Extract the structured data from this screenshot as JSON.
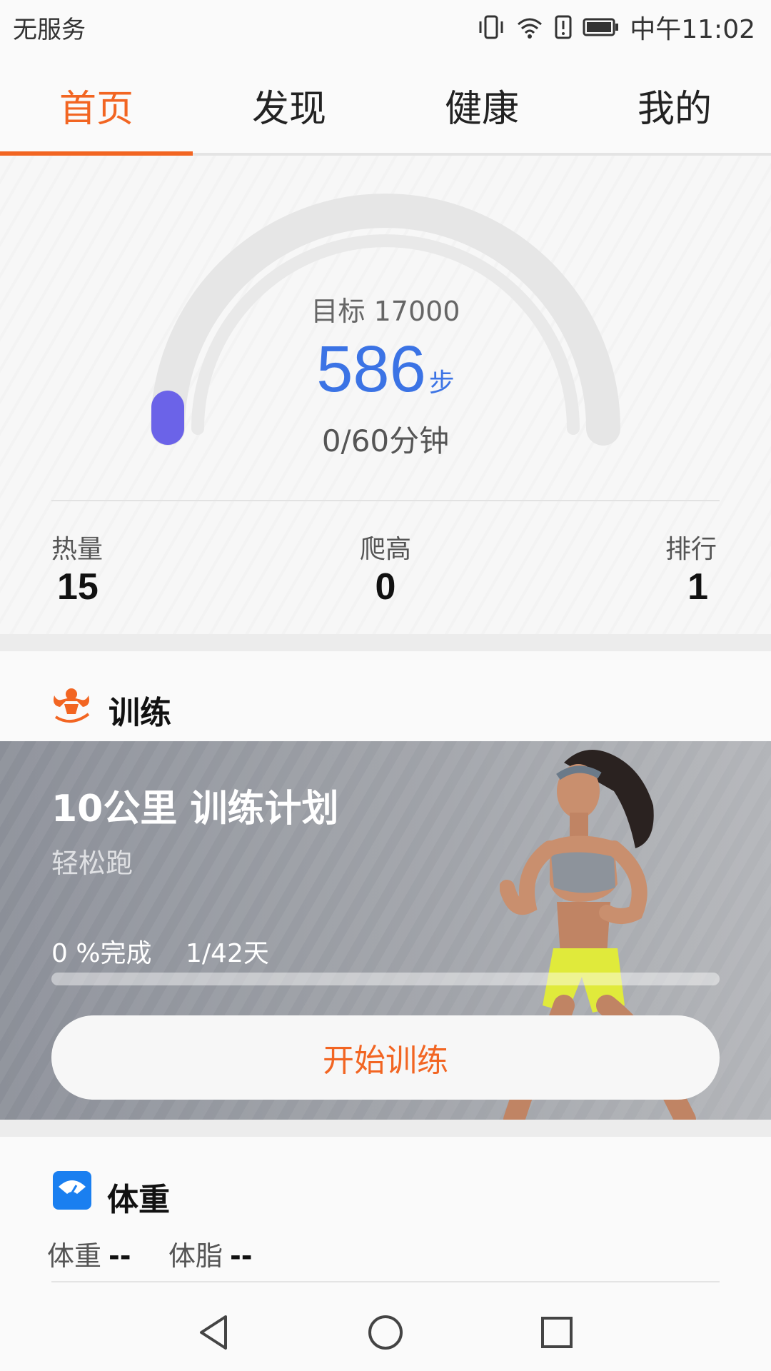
{
  "status_bar": {
    "carrier": "无服务",
    "time": "中午11:02",
    "icons": [
      "vibrate-icon",
      "wifi-icon",
      "alert-icon",
      "battery-icon"
    ]
  },
  "tabs": [
    {
      "label": "首页",
      "active": true
    },
    {
      "label": "发现",
      "active": false
    },
    {
      "label": "健康",
      "active": false
    },
    {
      "label": "我的",
      "active": false
    }
  ],
  "summary": {
    "goal_label": "目标 17000",
    "steps": "586",
    "steps_unit": "步",
    "minutes": "0/60分钟",
    "goal_progress_fraction": 0.03,
    "metrics": [
      {
        "label": "热量",
        "value": "15"
      },
      {
        "label": "爬高",
        "value": "0"
      },
      {
        "label": "排行",
        "value": "1"
      }
    ]
  },
  "training": {
    "section_title": "训练",
    "plan_title": "10公里 训练计划",
    "plan_subtitle": "轻松跑",
    "progress_label": "0 %完成",
    "days_label": "1/42天",
    "progress_fraction": 0,
    "start_button": "开始训练"
  },
  "weight": {
    "section_title": "体重",
    "items": [
      {
        "label": "体重",
        "value": "--"
      },
      {
        "label": "体脂",
        "value": "--"
      }
    ]
  },
  "colors": {
    "accent": "#f26522",
    "steps_blue": "#3b73e5",
    "gauge_marker": "#6b63e8",
    "weight_icon_blue": "#1a7ff0"
  },
  "nav_icons": [
    "back-icon",
    "home-icon",
    "recents-icon"
  ]
}
